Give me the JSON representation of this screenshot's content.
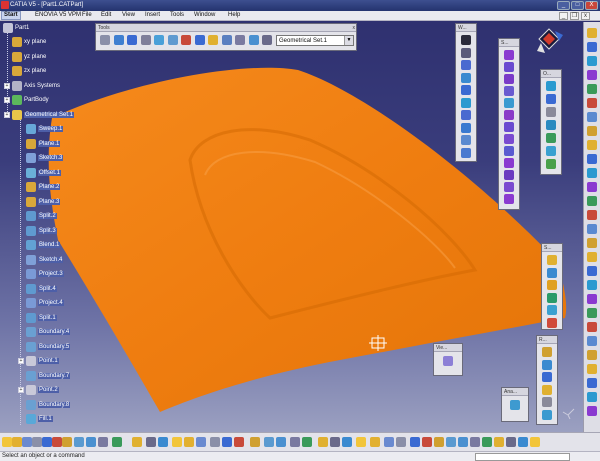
{
  "window": {
    "title": "CATIA V5 - [Part1.CATPart]",
    "controls": {
      "minimize": "_",
      "maximize": "□",
      "close": "X"
    }
  },
  "menubar": {
    "items": [
      "Start",
      "ENOVIA V5 VPM",
      "File",
      "Edit",
      "View",
      "Insert",
      "Tools",
      "Window",
      "Help"
    ],
    "mdi_controls": {
      "minimize": "_",
      "restore": "❐",
      "close": "x"
    }
  },
  "tree": {
    "root": "Part1",
    "items": [
      {
        "label": "xy plane",
        "icon": "plane-icon"
      },
      {
        "label": "yz plane",
        "icon": "plane-icon"
      },
      {
        "label": "zx plane",
        "icon": "plane-icon"
      },
      {
        "label": "Axis Systems",
        "icon": "axis-system-icon"
      },
      {
        "label": "PartBody",
        "icon": "part-body-icon"
      },
      {
        "label": "Geometrical Set.1",
        "icon": "geometrical-set-icon"
      },
      {
        "label": "Sweep.1",
        "icon": "sweep-icon"
      },
      {
        "label": "Plane.1",
        "icon": "plane-icon"
      },
      {
        "label": "Sketch.3",
        "icon": "sketch-icon"
      },
      {
        "label": "Offset.1",
        "icon": "offset-icon"
      },
      {
        "label": "Plane.2",
        "icon": "plane-icon"
      },
      {
        "label": "Plane.3",
        "icon": "plane-icon"
      },
      {
        "label": "Split.2",
        "icon": "split-icon"
      },
      {
        "label": "Split.3",
        "icon": "split-icon"
      },
      {
        "label": "Blend.1",
        "icon": "blend-icon"
      },
      {
        "label": "Sketch.4",
        "icon": "sketch-icon"
      },
      {
        "label": "Project.3",
        "icon": "project-icon"
      },
      {
        "label": "Split.4",
        "icon": "split-icon"
      },
      {
        "label": "Project.4",
        "icon": "project-icon"
      },
      {
        "label": "Split.1",
        "icon": "split-icon"
      },
      {
        "label": "Boundary.4",
        "icon": "boundary-icon"
      },
      {
        "label": "Boundary.5",
        "icon": "boundary-icon"
      },
      {
        "label": "Point.1",
        "icon": "point-icon"
      },
      {
        "label": "Boundary.7",
        "icon": "boundary-icon"
      },
      {
        "label": "Point.2",
        "icon": "point-icon"
      },
      {
        "label": "Boundary.8",
        "icon": "boundary-icon"
      },
      {
        "label": "Fill.1",
        "icon": "fill-icon"
      }
    ]
  },
  "tools_toolbar": {
    "title": "Tools",
    "geometrical_set_dropdown": "Geometrical Set.1"
  },
  "floating_toolbars": {
    "wireframe_title": "W...",
    "surfaces_title": "S...",
    "operations_title": "O...",
    "sketch_title": "S...",
    "view_title": "Vie...",
    "analysis_title": "Ana...",
    "replication_title": "R..."
  },
  "status": {
    "message": "Select an object or a command"
  },
  "colors": {
    "surface": "#f07f12",
    "selection": "#4d5fa8",
    "background_top": "#2d2f6e",
    "background_bottom": "#a7acc8"
  }
}
